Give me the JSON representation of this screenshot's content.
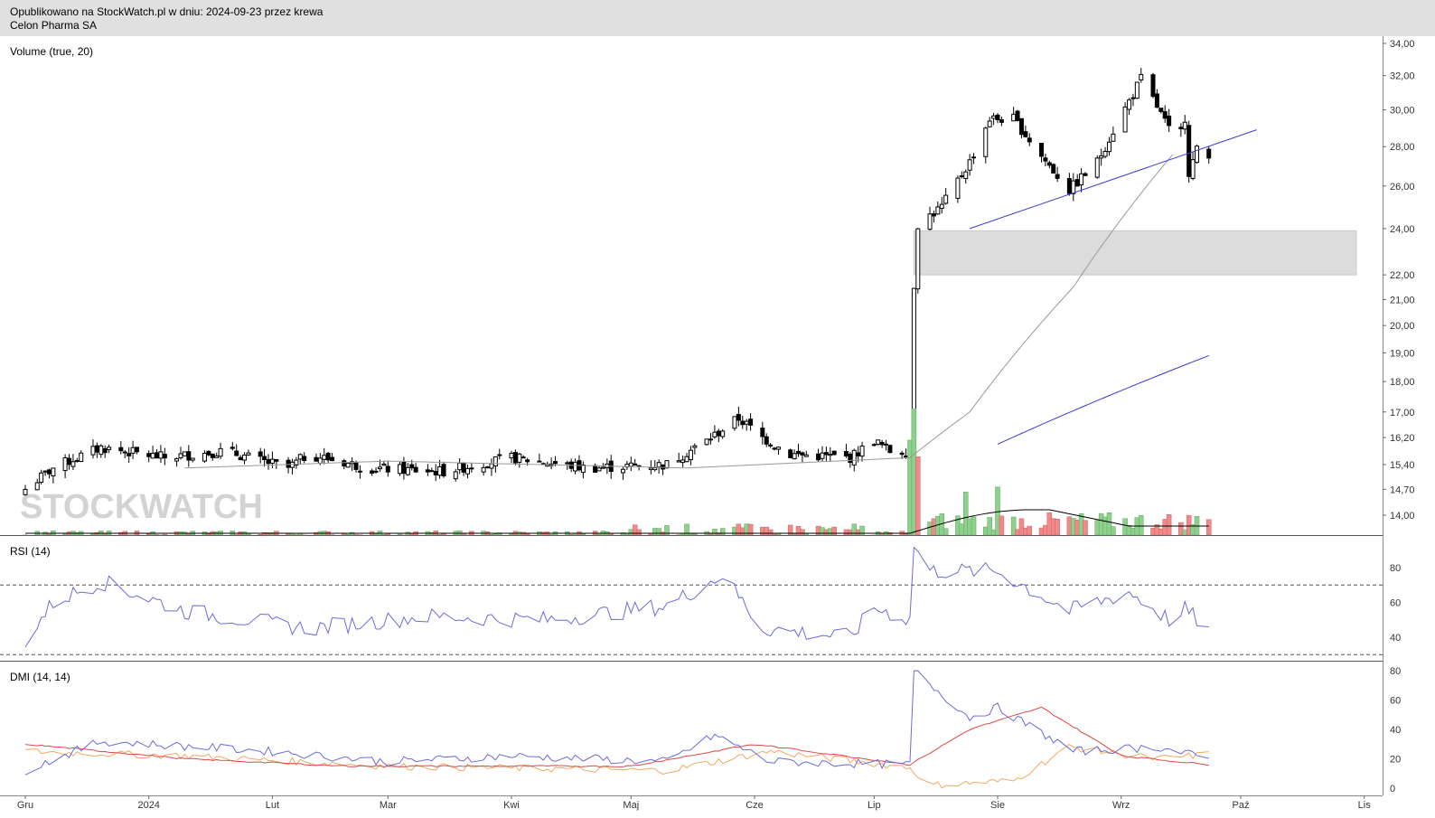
{
  "header": {
    "published_line": "Opublikowano na StockWatch.pl w dniu: 2024-09-23 przez krewa",
    "instrument": "Celon Pharma SA"
  },
  "watermark": "STOCKWATCH",
  "colors": {
    "up_volume": "#8fd08f",
    "down_volume": "#f08a8a",
    "sma": "#999999",
    "trend_line": "#3a3ad6",
    "rsi_line": "#6b6bd9",
    "dmi_plus": "#6b6bd9",
    "dmi_minus": "#f2a860",
    "adx": "#e04848",
    "zone": "#dcdcdc"
  },
  "chart_data": {
    "type": "candlestick",
    "date_range": [
      "2023-12-01",
      "2024-09-23"
    ],
    "x_ticks": [
      "Gru",
      "2024",
      "Lut",
      "Mar",
      "Kwi",
      "Maj",
      "Cze",
      "Lip",
      "Sie",
      "Wrz",
      "Paź",
      "Lis"
    ],
    "log_scale": true,
    "y_ticks": [
      "34,00",
      "32,00",
      "30,00",
      "28,00",
      "26,00",
      "24,00",
      "22,00",
      "21,00",
      "20,00",
      "19,00",
      "18,00",
      "17,00",
      "16,20",
      "15,40",
      "14,70",
      "14,00"
    ],
    "price_anchors": [
      {
        "date": "2023-12-01",
        "close": 14.7
      },
      {
        "date": "2023-12-08",
        "close": 15.3
      },
      {
        "date": "2023-12-20",
        "close": 15.9
      },
      {
        "date": "2024-01-05",
        "close": 15.6
      },
      {
        "date": "2024-01-20",
        "close": 15.8
      },
      {
        "date": "2024-02-05",
        "close": 15.3
      },
      {
        "date": "2024-02-10",
        "close": 15.7
      },
      {
        "date": "2024-02-25",
        "close": 15.3
      },
      {
        "date": "2024-03-15",
        "close": 15.2
      },
      {
        "date": "2024-04-01",
        "close": 15.6
      },
      {
        "date": "2024-04-20",
        "close": 15.3
      },
      {
        "date": "2024-05-10",
        "close": 15.4
      },
      {
        "date": "2024-05-20",
        "close": 16.1
      },
      {
        "date": "2024-05-28",
        "close": 16.8
      },
      {
        "date": "2024-06-03",
        "close": 16.2
      },
      {
        "date": "2024-06-10",
        "close": 15.7
      },
      {
        "date": "2024-06-25",
        "close": 15.6
      },
      {
        "date": "2024-07-01",
        "close": 16.1
      },
      {
        "date": "2024-07-05",
        "close": 15.8
      },
      {
        "date": "2024-07-10",
        "close": 15.8
      },
      {
        "date": "2024-07-11",
        "close": 21.6
      },
      {
        "date": "2024-07-12",
        "close": 24.2
      },
      {
        "date": "2024-07-18",
        "close": 25.0
      },
      {
        "date": "2024-07-25",
        "close": 27.2
      },
      {
        "date": "2024-07-30",
        "close": 29.5
      },
      {
        "date": "2024-08-05",
        "close": 29.5
      },
      {
        "date": "2024-08-12",
        "close": 27.5
      },
      {
        "date": "2024-08-19",
        "close": 25.8
      },
      {
        "date": "2024-08-26",
        "close": 27.2
      },
      {
        "date": "2024-09-03",
        "close": 30.5
      },
      {
        "date": "2024-09-06",
        "close": 31.8
      },
      {
        "date": "2024-09-10",
        "close": 30.2
      },
      {
        "date": "2024-09-15",
        "close": 28.0
      },
      {
        "date": "2024-09-17",
        "close": 29.6
      },
      {
        "date": "2024-09-18",
        "close": 26.7
      },
      {
        "date": "2024-09-20",
        "close": 27.8
      },
      {
        "date": "2024-09-23",
        "close": 27.4
      }
    ],
    "sma_50_anchors": [
      {
        "date": "2024-01-10",
        "value": 15.3
      },
      {
        "date": "2024-03-01",
        "value": 15.5
      },
      {
        "date": "2024-05-15",
        "value": 15.3
      },
      {
        "date": "2024-07-10",
        "value": 15.6
      },
      {
        "date": "2024-07-25",
        "value": 17.0
      },
      {
        "date": "2024-08-20",
        "value": 21.5
      },
      {
        "date": "2024-09-14",
        "value": 27.6
      }
    ],
    "sma_200_anchors": [
      {
        "date": "2024-08-01",
        "value": 16.0
      },
      {
        "date": "2024-09-23",
        "value": 18.9
      }
    ],
    "trend_line": {
      "from": {
        "date": "2024-07-25",
        "value": 24.0
      },
      "to": {
        "date": "2024-10-05",
        "value": 28.9
      }
    },
    "support_zone": {
      "from_date": "2024-07-11",
      "to_date": "2024-10-30",
      "low": 22.0,
      "high": 23.9
    },
    "volume_panel": {
      "label": "Volume (true, 20)",
      "big_bars": [
        {
          "date": "2024-07-10",
          "rel": 0.75,
          "up": true
        },
        {
          "date": "2024-07-11",
          "rel": 1.0,
          "up": true
        },
        {
          "date": "2024-07-12",
          "rel": 0.62,
          "up": false
        },
        {
          "date": "2024-07-24",
          "rel": 0.34,
          "up": true
        },
        {
          "date": "2024-08-01",
          "rel": 0.38,
          "up": true
        }
      ]
    },
    "rsi_panel": {
      "label": "RSI (14)",
      "y_ticks": [
        80,
        60,
        40
      ],
      "levels": [
        70,
        30
      ],
      "anchors": [
        {
          "date": "2023-12-01",
          "value": 38
        },
        {
          "date": "2023-12-08",
          "value": 60
        },
        {
          "date": "2023-12-20",
          "value": 72
        },
        {
          "date": "2024-01-10",
          "value": 55
        },
        {
          "date": "2024-02-10",
          "value": 45
        },
        {
          "date": "2024-03-10",
          "value": 52
        },
        {
          "date": "2024-04-10",
          "value": 50
        },
        {
          "date": "2024-05-10",
          "value": 58
        },
        {
          "date": "2024-05-24",
          "value": 76
        },
        {
          "date": "2024-06-03",
          "value": 45
        },
        {
          "date": "2024-06-25",
          "value": 40
        },
        {
          "date": "2024-07-01",
          "value": 57
        },
        {
          "date": "2024-07-10",
          "value": 50
        },
        {
          "date": "2024-07-11",
          "value": 93
        },
        {
          "date": "2024-07-15",
          "value": 78
        },
        {
          "date": "2024-08-01",
          "value": 78
        },
        {
          "date": "2024-08-19",
          "value": 55
        },
        {
          "date": "2024-09-03",
          "value": 66
        },
        {
          "date": "2024-09-15",
          "value": 47
        },
        {
          "date": "2024-09-17",
          "value": 56
        },
        {
          "date": "2024-09-23",
          "value": 44
        }
      ]
    },
    "dmi_panel": {
      "label": "DMI (14, 14)",
      "y_ticks": [
        80,
        60,
        40,
        20,
        0
      ],
      "plus_di": [
        {
          "date": "2023-12-01",
          "value": 12
        },
        {
          "date": "2023-12-20",
          "value": 32
        },
        {
          "date": "2024-02-01",
          "value": 25
        },
        {
          "date": "2024-03-01",
          "value": 18
        },
        {
          "date": "2024-04-01",
          "value": 22
        },
        {
          "date": "2024-05-10",
          "value": 18
        },
        {
          "date": "2024-05-22",
          "value": 36
        },
        {
          "date": "2024-06-05",
          "value": 18
        },
        {
          "date": "2024-07-10",
          "value": 16
        },
        {
          "date": "2024-07-11",
          "value": 80
        },
        {
          "date": "2024-07-25",
          "value": 48
        },
        {
          "date": "2024-08-01",
          "value": 55
        },
        {
          "date": "2024-08-20",
          "value": 25
        },
        {
          "date": "2024-09-10",
          "value": 28
        },
        {
          "date": "2024-09-23",
          "value": 20
        }
      ],
      "minus_di": [
        {
          "date": "2023-12-01",
          "value": 25
        },
        {
          "date": "2024-01-10",
          "value": 22
        },
        {
          "date": "2024-03-01",
          "value": 15
        },
        {
          "date": "2024-05-10",
          "value": 12
        },
        {
          "date": "2024-06-05",
          "value": 25
        },
        {
          "date": "2024-07-10",
          "value": 14
        },
        {
          "date": "2024-07-15",
          "value": 2
        },
        {
          "date": "2024-08-05",
          "value": 5
        },
        {
          "date": "2024-08-19",
          "value": 28
        },
        {
          "date": "2024-09-10",
          "value": 20
        },
        {
          "date": "2024-09-23",
          "value": 23
        }
      ],
      "adx": [
        {
          "date": "2023-12-01",
          "value": 30
        },
        {
          "date": "2024-01-10",
          "value": 20
        },
        {
          "date": "2024-02-20",
          "value": 15
        },
        {
          "date": "2024-05-01",
          "value": 15
        },
        {
          "date": "2024-06-01",
          "value": 30
        },
        {
          "date": "2024-07-10",
          "value": 16
        },
        {
          "date": "2024-07-25",
          "value": 40
        },
        {
          "date": "2024-08-12",
          "value": 55
        },
        {
          "date": "2024-09-01",
          "value": 22
        },
        {
          "date": "2024-09-23",
          "value": 16
        }
      ]
    }
  }
}
